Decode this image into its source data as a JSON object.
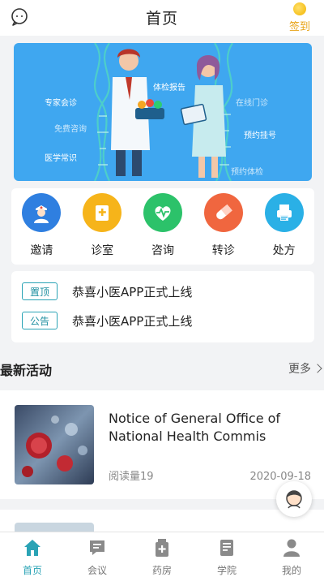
{
  "header": {
    "title": "首页",
    "signin_label": "签到",
    "left_icon": "chat-bubble-icon"
  },
  "banner": {
    "labels": [
      "专家会诊",
      "免费咨询",
      "医学常识",
      "体检报告",
      "在线门诊",
      "预约挂号",
      "预约体检"
    ]
  },
  "quick_menu": [
    {
      "label": "邀请",
      "icon": "nurse-icon",
      "color": "#2f7fe0"
    },
    {
      "label": "诊室",
      "icon": "clinic-icon",
      "color": "#f6b41a"
    },
    {
      "label": "咨询",
      "icon": "heart-pulse-icon",
      "color": "#2cc26a"
    },
    {
      "label": "转诊",
      "icon": "pill-icon",
      "color": "#f0663f"
    },
    {
      "label": "处方",
      "icon": "printer-icon",
      "color": "#2ab0e6"
    }
  ],
  "notices": [
    {
      "tag": "置顶",
      "text": "恭喜小医APP正式上线"
    },
    {
      "tag": "公告",
      "text": "恭喜小医APP正式上线"
    }
  ],
  "section": {
    "title": "最新活动",
    "more": "更多"
  },
  "articles": [
    {
      "title": "Notice of General Office of National Health Commis",
      "reads": "阅读量19",
      "date": "2020-09-18"
    }
  ],
  "tabbar": [
    {
      "label": "首页",
      "icon": "home-icon",
      "active": true
    },
    {
      "label": "会议",
      "icon": "meeting-icon",
      "active": false
    },
    {
      "label": "药房",
      "icon": "pharmacy-icon",
      "active": false
    },
    {
      "label": "学院",
      "icon": "book-icon",
      "active": false
    },
    {
      "label": "我的",
      "icon": "user-icon",
      "active": false
    }
  ],
  "colors": {
    "accent": "#2aa3b5",
    "banner_bg": "#3fa7f0",
    "signin": "#e8a317"
  }
}
